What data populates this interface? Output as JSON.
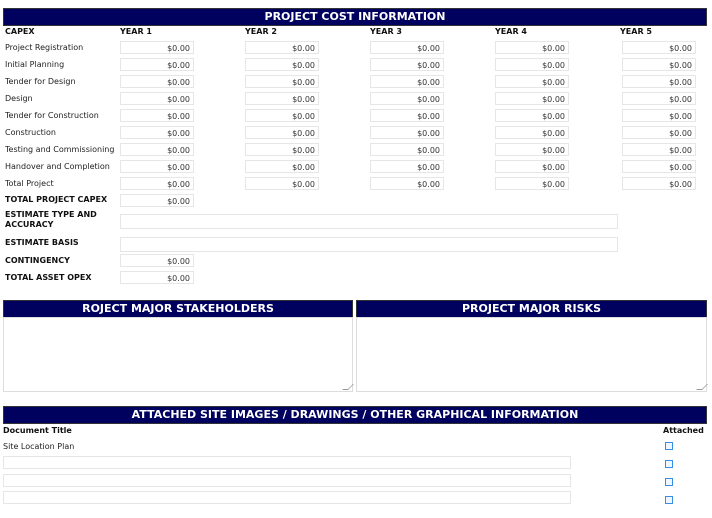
{
  "cost": {
    "title": "PROJECT COST INFORMATION",
    "col_headers": [
      "CAPEX",
      "YEAR 1",
      "YEAR 2",
      "YEAR 3",
      "YEAR 4",
      "YEAR 5"
    ],
    "rows": [
      {
        "label": "Project Registration",
        "values": [
          "$0.00",
          "$0.00",
          "$0.00",
          "$0.00",
          "$0.00"
        ]
      },
      {
        "label": "Initial Planning",
        "values": [
          "$0.00",
          "$0.00",
          "$0.00",
          "$0.00",
          "$0.00"
        ]
      },
      {
        "label": "Tender for Design",
        "values": [
          "$0.00",
          "$0.00",
          "$0.00",
          "$0.00",
          "$0.00"
        ]
      },
      {
        "label": "Design",
        "values": [
          "$0.00",
          "$0.00",
          "$0.00",
          "$0.00",
          "$0.00"
        ]
      },
      {
        "label": "Tender for Construction",
        "values": [
          "$0.00",
          "$0.00",
          "$0.00",
          "$0.00",
          "$0.00"
        ]
      },
      {
        "label": "Construction",
        "values": [
          "$0.00",
          "$0.00",
          "$0.00",
          "$0.00",
          "$0.00"
        ]
      },
      {
        "label": "Testing and Commissioning",
        "values": [
          "$0.00",
          "$0.00",
          "$0.00",
          "$0.00",
          "$0.00"
        ]
      },
      {
        "label": "Handover and Completion",
        "values": [
          "$0.00",
          "$0.00",
          "$0.00",
          "$0.00",
          "$0.00"
        ]
      },
      {
        "label": "Total Project",
        "values": [
          "$0.00",
          "$0.00",
          "$0.00",
          "$0.00",
          "$0.00"
        ]
      }
    ],
    "total_capex": {
      "label": "TOTAL PROJECT CAPEX",
      "value": "$0.00"
    },
    "estimate_type": {
      "label": "ESTIMATE TYPE AND ACCURACY",
      "value": ""
    },
    "estimate_basis": {
      "label": "ESTIMATE BASIS",
      "value": ""
    },
    "contingency": {
      "label": "CONTINGENCY",
      "value": "$0.00"
    },
    "total_opex": {
      "label": "TOTAL ASSET OPEX",
      "value": "$0.00"
    }
  },
  "stakeholders": {
    "title": "ROJECT MAJOR STAKEHOLDERS",
    "value": ""
  },
  "risks": {
    "title": "PROJECT MAJOR RISKS",
    "value": ""
  },
  "attachments": {
    "title": "ATTACHED SITE IMAGES / DRAWINGS / OTHER GRAPHICAL INFORMATION",
    "doc_header": "Document Title",
    "attached_header": "Attached",
    "rows": [
      {
        "title": "Site Location Plan",
        "attached": false
      },
      {
        "title": "",
        "attached": false
      },
      {
        "title": "",
        "attached": false
      },
      {
        "title": "",
        "attached": false
      }
    ]
  },
  "colors": {
    "header": "#00005e",
    "checkbox": "#3a8ee0"
  }
}
